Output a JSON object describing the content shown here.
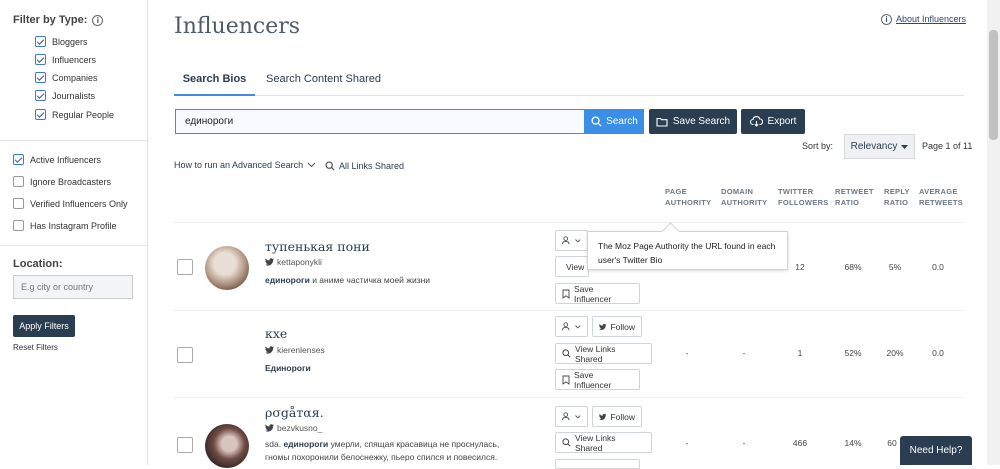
{
  "sidebar": {
    "filter_title": "Filter by Type:",
    "types": [
      {
        "label": "Bloggers",
        "checked": true
      },
      {
        "label": "Influencers",
        "checked": true
      },
      {
        "label": "Companies",
        "checked": true
      },
      {
        "label": "Journalists",
        "checked": true
      },
      {
        "label": "Regular People",
        "checked": true
      }
    ],
    "options": [
      {
        "label": "Active Influencers",
        "checked": true
      },
      {
        "label": "Ignore Broadcasters",
        "checked": false
      },
      {
        "label": "Verified Influencers Only",
        "checked": false
      },
      {
        "label": "Has Instagram Profile",
        "checked": false
      }
    ],
    "location_title": "Location:",
    "location_placeholder": "E.g city or country",
    "apply_label": "Apply Filters",
    "reset_label": "Reset Filters"
  },
  "header": {
    "title": "Influencers",
    "about_label": "About Influencers"
  },
  "tabs": [
    {
      "label": "Search Bios",
      "active": true
    },
    {
      "label": "Search Content Shared",
      "active": false
    }
  ],
  "search": {
    "value": "единороги",
    "search_label": "Search",
    "save_label": "Save Search",
    "export_label": "Export"
  },
  "sort": {
    "label": "Sort by:",
    "value": "Relevancy",
    "page_info": "Page 1 of 11"
  },
  "links": {
    "advanced": "How to run an Advanced Search",
    "all_links": "All Links Shared"
  },
  "columns": [
    [
      "PAGE",
      "AUTHORITY"
    ],
    [
      "DOMAIN",
      "AUTHORITY"
    ],
    [
      "TWITTER",
      "FOLLOWERS"
    ],
    [
      "RETWEET",
      "RATIO"
    ],
    [
      "REPLY",
      "RATIO"
    ],
    [
      "AVERAGE",
      "RETWEETS"
    ]
  ],
  "rows": [
    {
      "name": "тупенькая пони",
      "handle": "kettaponykli",
      "bio_bold": "единороги",
      "bio_rest": " и аниме частичка моей жизни",
      "follow_label": "",
      "links_label": "View",
      "save_label": "Save Influencer",
      "values": [
        "",
        "",
        "12",
        "68%",
        "5%",
        "0.0"
      ]
    },
    {
      "name": "кхе",
      "handle": "kierenlenses",
      "bio_bold": "Единороги",
      "bio_rest": "",
      "follow_label": "Follow",
      "links_label": "View Links Shared",
      "save_label": "Save Influencer",
      "values": [
        "-",
        "-",
        "1",
        "52%",
        "20%",
        "0.0"
      ]
    },
    {
      "name": "ρσgåтαя.",
      "handle": "bezvkusno_",
      "bio_prefix": "sda. ",
      "bio_bold": "единороги",
      "bio_rest": " умерли, спящая красавица не проснулась, гномы похоронили белоснежку, пьеро спился и повесился.",
      "follow_label": "Follow",
      "links_label": "View Links Shared",
      "save_label": "",
      "values": [
        "-",
        "-",
        "466",
        "14%",
        "60",
        ""
      ]
    }
  ],
  "tooltip": "The Moz Page Authority the URL found in each user's Twitter Bio",
  "help_label": "Need Help?",
  "colors": {
    "accent": "#3a8ee6",
    "dark": "#2b3e51"
  }
}
